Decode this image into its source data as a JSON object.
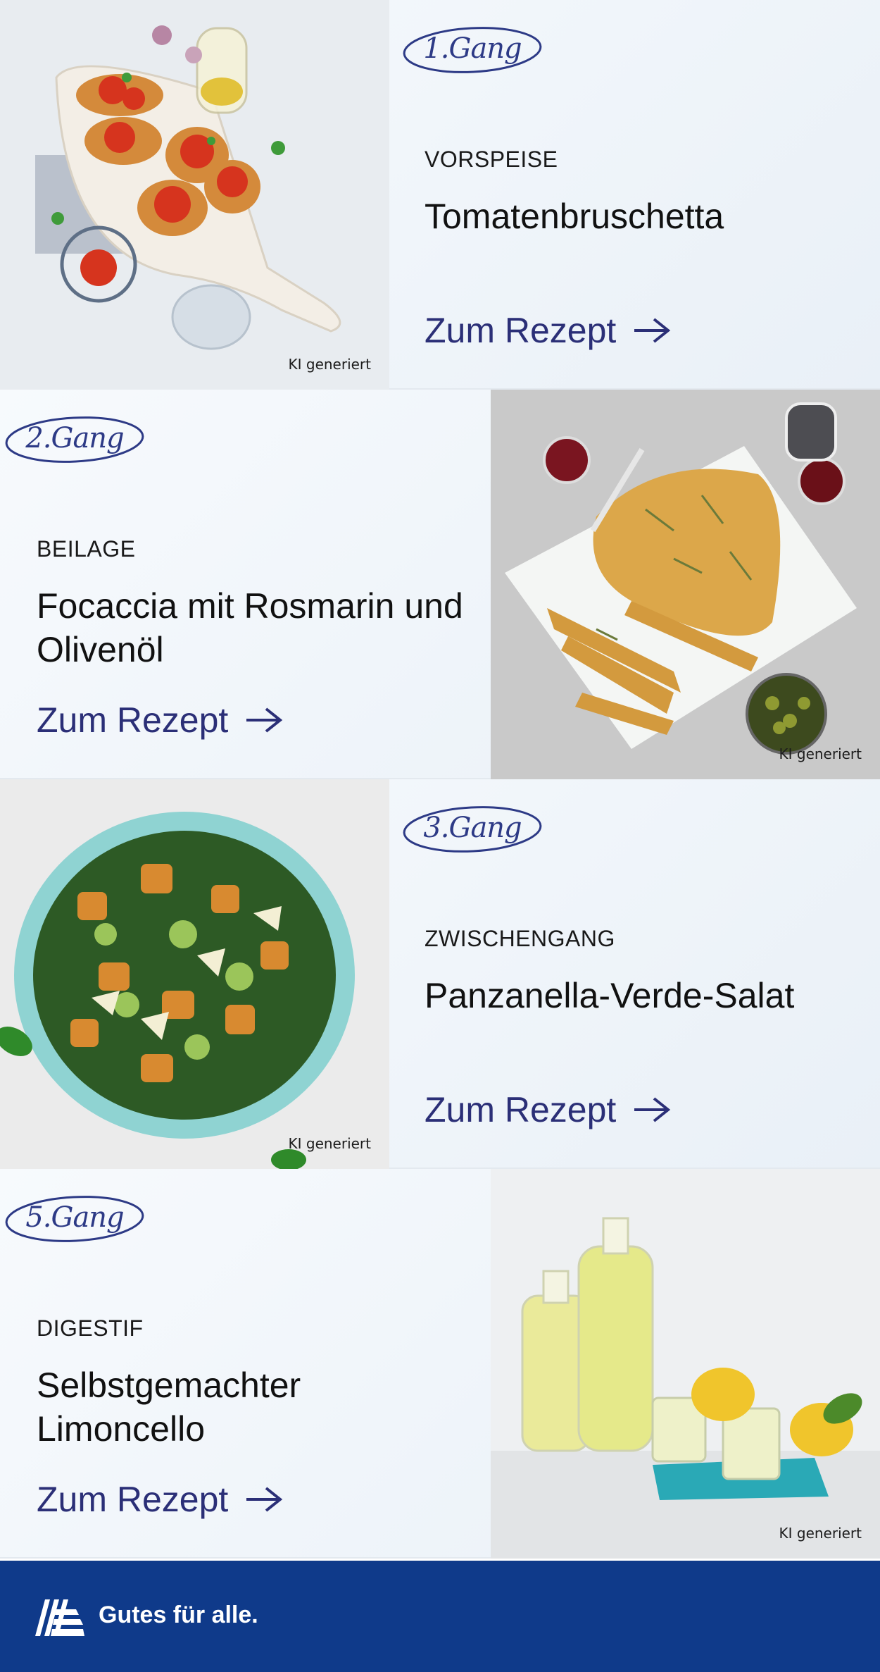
{
  "courses": [
    {
      "gang": "1.Gang",
      "category": "VORSPEISE",
      "title": "Tomatenbruschetta",
      "link": "Zum Rezept",
      "ki_label": "KI generiert"
    },
    {
      "gang": "2.Gang",
      "category": "BEILAGE",
      "title": "Focaccia mit Rosmarin und Olivenöl",
      "link": "Zum Rezept",
      "ki_label": "KI generiert"
    },
    {
      "gang": "3.Gang",
      "category": "ZWISCHENGANG",
      "title": "Panzanella-Verde-Salat",
      "link": "Zum Rezept",
      "ki_label": "KI generiert"
    },
    {
      "gang": "5.Gang",
      "category": "DIGESTIF",
      "title": "Selbstgemachter Limoncello",
      "link": "Zum Rezept",
      "ki_label": "KI generiert"
    }
  ],
  "footer": {
    "slogan": "Gutes für alle."
  },
  "colors": {
    "link": "#2b2f77",
    "badge": "#2d3a86",
    "footer_bg": "#0f3a8a"
  },
  "icons": {
    "arrow": "arrow-right-icon",
    "logo": "brand-logo-icon"
  }
}
